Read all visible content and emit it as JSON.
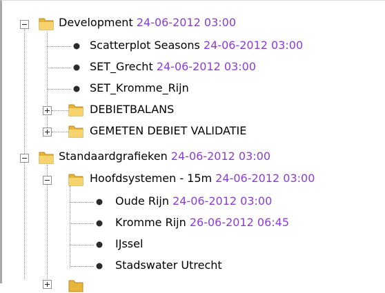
{
  "tree": {
    "nodes": [
      {
        "label": "Development",
        "timestamp": "24-06-2012 03:00"
      },
      {
        "label": "Scatterplot Seasons",
        "timestamp": "24-06-2012 03:00"
      },
      {
        "label": "SET_Grecht",
        "timestamp": "24-06-2012 03:00"
      },
      {
        "label": "SET_Kromme_Rijn",
        "timestamp": ""
      },
      {
        "label": "DEBIETBALANS",
        "timestamp": ""
      },
      {
        "label": "GEMETEN DEBIET VALIDATIE",
        "timestamp": ""
      },
      {
        "label": "Standaardgrafieken",
        "timestamp": "24-06-2012 03:00"
      },
      {
        "label": "Hoofdsystemen - 15m",
        "timestamp": "24-06-2012 03:00"
      },
      {
        "label": "Oude Rijn",
        "timestamp": "24-06-2012 03:00"
      },
      {
        "label": "Kromme Rijn",
        "timestamp": "26-06-2012 06:45"
      },
      {
        "label": "IJssel",
        "timestamp": ""
      },
      {
        "label": "Stadswater Utrecht",
        "timestamp": ""
      }
    ]
  },
  "colors": {
    "timestamp": "#8b3cd6",
    "folder": "#f0c24a",
    "connector": "#8c8c8c"
  }
}
